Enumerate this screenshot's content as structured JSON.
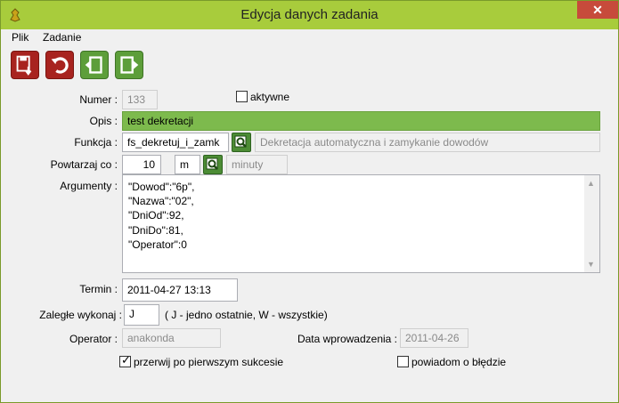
{
  "window": {
    "title": "Edycja danych zadania",
    "close_glyph": "✕"
  },
  "menu": [
    "Plik",
    "Zadanie"
  ],
  "toolbar": {
    "save_icon": "save-icon",
    "undo_icon": "undo-icon",
    "prev_icon": "previous-icon",
    "next_icon": "next-icon"
  },
  "form": {
    "numer": {
      "label": "Numer :",
      "value": "133"
    },
    "aktywne": {
      "label": "aktywne",
      "checked": false
    },
    "opis": {
      "label": "Opis :",
      "value": "test dekretacji"
    },
    "funkcja": {
      "label": "Funkcja :",
      "value": "fs_dekretuj_i_zamk",
      "description": "Dekretacja automatyczna i zamykanie dowodów"
    },
    "powtarzaj": {
      "label": "Powtarzaj co :",
      "value": "10",
      "unit": "m",
      "unit_desc": "minuty"
    },
    "argumenty": {
      "label": "Argumenty :",
      "lines": [
        "\"Dowod\":\"6p\",",
        "\"Nazwa\":\"02\",",
        "\"DniOd\":92,",
        "\"DniDo\":81,",
        "\"Operator\":0"
      ]
    },
    "termin": {
      "label": "Termin :",
      "value": "2011-04-27 13:13"
    },
    "zalegle": {
      "label": "Zaległe wykonaj :",
      "value": "J",
      "hint": "( J - jedno ostatnie, W - wszystkie)"
    },
    "operator": {
      "label": "Operator :",
      "value": "anakonda"
    },
    "data_wprowadzenia": {
      "label": "Data wprowadzenia :",
      "value": "2011-04-26"
    },
    "przerwij": {
      "label": "przerwij po pierwszym sukcesie",
      "checked": true
    },
    "powiadom": {
      "label": "powiadom o błędzie",
      "checked": false
    }
  },
  "colors": {
    "titlebar": "#a8cc3c",
    "save_red": "#a8231f",
    "nav_green": "#5d9e3a",
    "opis_green": "#7dba4d"
  }
}
